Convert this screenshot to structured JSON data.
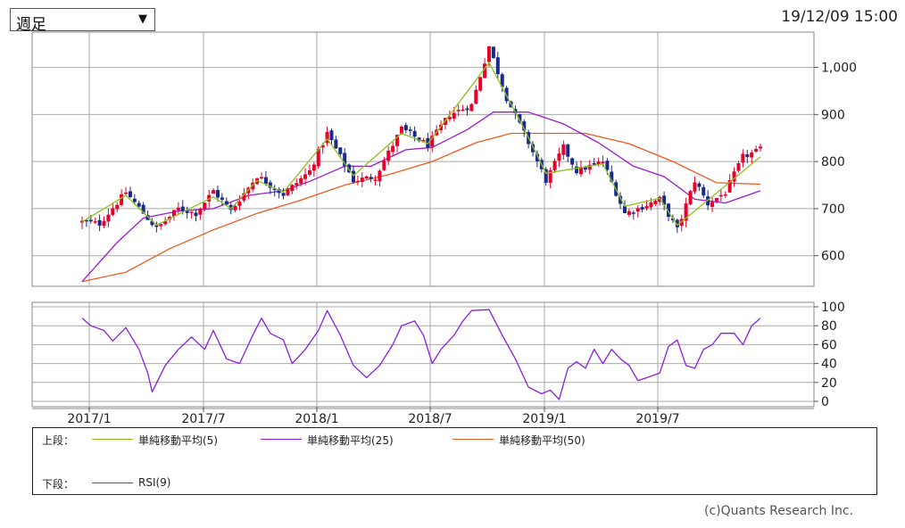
{
  "controls": {
    "period_select": {
      "value": "週足"
    },
    "timestamp": "19/12/09 15:00"
  },
  "colors": {
    "up": "#e8002a",
    "down": "#1a2a8c",
    "ma5": "#8dc21f",
    "ma25": "#9a1ad6",
    "ma50": "#ee5a1e",
    "rsi": "#8a1ee6",
    "grid": "#aaaaaa"
  },
  "legend": {
    "upper_label": "上段：",
    "lower_label": "下段：",
    "items": [
      {
        "name": "単純移動平均(5)"
      },
      {
        "name": "単純移動平均(25)"
      },
      {
        "name": "単純移動平均(50)"
      },
      {
        "name": "RSI(9)"
      }
    ]
  },
  "copyright": "(c)Quants Research Inc.",
  "chart_data": [
    {
      "type": "candlestick",
      "x_ticks": [
        "2017/1",
        "2017/7",
        "2018/1",
        "2018/7",
        "2019/1",
        "2019/7"
      ],
      "y_ticks": [
        "600",
        "700",
        "800",
        "900",
        "1,000"
      ],
      "ylim": [
        535,
        1075
      ],
      "grid": true,
      "price_anchors": [
        {
          "t": 0,
          "p": 672
        },
        {
          "t": 4,
          "p": 668
        },
        {
          "t": 10,
          "p": 735
        },
        {
          "t": 17,
          "p": 657
        },
        {
          "t": 22,
          "p": 700
        },
        {
          "t": 26,
          "p": 690
        },
        {
          "t": 30,
          "p": 738
        },
        {
          "t": 34,
          "p": 695
        },
        {
          "t": 40,
          "p": 770
        },
        {
          "t": 46,
          "p": 730
        },
        {
          "t": 52,
          "p": 780
        },
        {
          "t": 56,
          "p": 860
        },
        {
          "t": 62,
          "p": 760
        },
        {
          "t": 67,
          "p": 768
        },
        {
          "t": 73,
          "p": 870
        },
        {
          "t": 79,
          "p": 835
        },
        {
          "t": 84,
          "p": 900
        },
        {
          "t": 89,
          "p": 920
        },
        {
          "t": 93,
          "p": 1045
        },
        {
          "t": 97,
          "p": 935
        },
        {
          "t": 101,
          "p": 860
        },
        {
          "t": 106,
          "p": 760
        },
        {
          "t": 110,
          "p": 830
        },
        {
          "t": 113,
          "p": 780
        },
        {
          "t": 119,
          "p": 800
        },
        {
          "t": 124,
          "p": 690
        },
        {
          "t": 127,
          "p": 700
        },
        {
          "t": 132,
          "p": 720
        },
        {
          "t": 136,
          "p": 655
        },
        {
          "t": 140,
          "p": 760
        },
        {
          "t": 143,
          "p": 710
        },
        {
          "t": 147,
          "p": 735
        },
        {
          "t": 151,
          "p": 810
        },
        {
          "t": 155,
          "p": 825
        }
      ],
      "sma_5": [
        {
          "t": 0,
          "p": 672
        },
        {
          "t": 10,
          "p": 728
        },
        {
          "t": 17,
          "p": 665
        },
        {
          "t": 30,
          "p": 725
        },
        {
          "t": 34,
          "p": 700
        },
        {
          "t": 40,
          "p": 760
        },
        {
          "t": 46,
          "p": 735
        },
        {
          "t": 56,
          "p": 848
        },
        {
          "t": 62,
          "p": 770
        },
        {
          "t": 73,
          "p": 860
        },
        {
          "t": 79,
          "p": 838
        },
        {
          "t": 93,
          "p": 1010
        },
        {
          "t": 101,
          "p": 870
        },
        {
          "t": 106,
          "p": 775
        },
        {
          "t": 119,
          "p": 795
        },
        {
          "t": 124,
          "p": 705
        },
        {
          "t": 132,
          "p": 722
        },
        {
          "t": 136,
          "p": 665
        },
        {
          "t": 143,
          "p": 718
        },
        {
          "t": 155,
          "p": 810
        }
      ],
      "sma_25": [
        {
          "t": 0,
          "p": 545
        },
        {
          "t": 8,
          "p": 628
        },
        {
          "t": 14,
          "p": 680
        },
        {
          "t": 22,
          "p": 695
        },
        {
          "t": 30,
          "p": 700
        },
        {
          "t": 38,
          "p": 728
        },
        {
          "t": 46,
          "p": 738
        },
        {
          "t": 52,
          "p": 758
        },
        {
          "t": 60,
          "p": 790
        },
        {
          "t": 66,
          "p": 790
        },
        {
          "t": 74,
          "p": 825
        },
        {
          "t": 80,
          "p": 830
        },
        {
          "t": 88,
          "p": 868
        },
        {
          "t": 94,
          "p": 905
        },
        {
          "t": 102,
          "p": 905
        },
        {
          "t": 110,
          "p": 880
        },
        {
          "t": 118,
          "p": 840
        },
        {
          "t": 126,
          "p": 790
        },
        {
          "t": 133,
          "p": 768
        },
        {
          "t": 140,
          "p": 720
        },
        {
          "t": 147,
          "p": 712
        },
        {
          "t": 155,
          "p": 738
        }
      ],
      "sma_50": [
        {
          "t": 0,
          "p": 545
        },
        {
          "t": 10,
          "p": 565
        },
        {
          "t": 20,
          "p": 615
        },
        {
          "t": 30,
          "p": 655
        },
        {
          "t": 40,
          "p": 690
        },
        {
          "t": 50,
          "p": 718
        },
        {
          "t": 60,
          "p": 750
        },
        {
          "t": 70,
          "p": 772
        },
        {
          "t": 80,
          "p": 800
        },
        {
          "t": 90,
          "p": 840
        },
        {
          "t": 98,
          "p": 860
        },
        {
          "t": 105,
          "p": 860
        },
        {
          "t": 115,
          "p": 860
        },
        {
          "t": 125,
          "p": 838
        },
        {
          "t": 135,
          "p": 800
        },
        {
          "t": 145,
          "p": 755
        },
        {
          "t": 155,
          "p": 752
        }
      ]
    },
    {
      "type": "line",
      "y_ticks": [
        "0",
        "20",
        "40",
        "60",
        "80",
        "100"
      ],
      "ylim": [
        0,
        100
      ],
      "grid": true,
      "series": [
        {
          "name": "RSI(9)",
          "points": [
            {
              "t": 0,
              "v": 88
            },
            {
              "t": 2,
              "v": 80
            },
            {
              "t": 5,
              "v": 75
            },
            {
              "t": 7,
              "v": 64
            },
            {
              "t": 10,
              "v": 78
            },
            {
              "t": 13,
              "v": 55
            },
            {
              "t": 15,
              "v": 30
            },
            {
              "t": 16,
              "v": 10
            },
            {
              "t": 19,
              "v": 38
            },
            {
              "t": 22,
              "v": 55
            },
            {
              "t": 25,
              "v": 68
            },
            {
              "t": 28,
              "v": 55
            },
            {
              "t": 30,
              "v": 75
            },
            {
              "t": 33,
              "v": 45
            },
            {
              "t": 36,
              "v": 40
            },
            {
              "t": 39,
              "v": 70
            },
            {
              "t": 41,
              "v": 88
            },
            {
              "t": 43,
              "v": 72
            },
            {
              "t": 46,
              "v": 65
            },
            {
              "t": 48,
              "v": 40
            },
            {
              "t": 51,
              "v": 55
            },
            {
              "t": 54,
              "v": 75
            },
            {
              "t": 56,
              "v": 96
            },
            {
              "t": 59,
              "v": 70
            },
            {
              "t": 62,
              "v": 38
            },
            {
              "t": 65,
              "v": 25
            },
            {
              "t": 68,
              "v": 38
            },
            {
              "t": 71,
              "v": 60
            },
            {
              "t": 73,
              "v": 80
            },
            {
              "t": 76,
              "v": 85
            },
            {
              "t": 78,
              "v": 70
            },
            {
              "t": 80,
              "v": 40
            },
            {
              "t": 82,
              "v": 55
            },
            {
              "t": 85,
              "v": 70
            },
            {
              "t": 87,
              "v": 85
            },
            {
              "t": 89,
              "v": 96
            },
            {
              "t": 93,
              "v": 97
            },
            {
              "t": 96,
              "v": 70
            },
            {
              "t": 99,
              "v": 45
            },
            {
              "t": 102,
              "v": 15
            },
            {
              "t": 105,
              "v": 8
            },
            {
              "t": 107,
              "v": 12
            },
            {
              "t": 109,
              "v": 2
            },
            {
              "t": 111,
              "v": 35
            },
            {
              "t": 113,
              "v": 42
            },
            {
              "t": 115,
              "v": 35
            },
            {
              "t": 117,
              "v": 55
            },
            {
              "t": 119,
              "v": 40
            },
            {
              "t": 121,
              "v": 55
            },
            {
              "t": 123,
              "v": 45
            },
            {
              "t": 125,
              "v": 38
            },
            {
              "t": 127,
              "v": 22
            },
            {
              "t": 129,
              "v": 25
            },
            {
              "t": 132,
              "v": 30
            },
            {
              "t": 134,
              "v": 58
            },
            {
              "t": 136,
              "v": 65
            },
            {
              "t": 138,
              "v": 38
            },
            {
              "t": 140,
              "v": 35
            },
            {
              "t": 142,
              "v": 55
            },
            {
              "t": 144,
              "v": 60
            },
            {
              "t": 146,
              "v": 72
            },
            {
              "t": 149,
              "v": 72
            },
            {
              "t": 151,
              "v": 60
            },
            {
              "t": 153,
              "v": 80
            },
            {
              "t": 155,
              "v": 88
            }
          ]
        }
      ]
    }
  ]
}
